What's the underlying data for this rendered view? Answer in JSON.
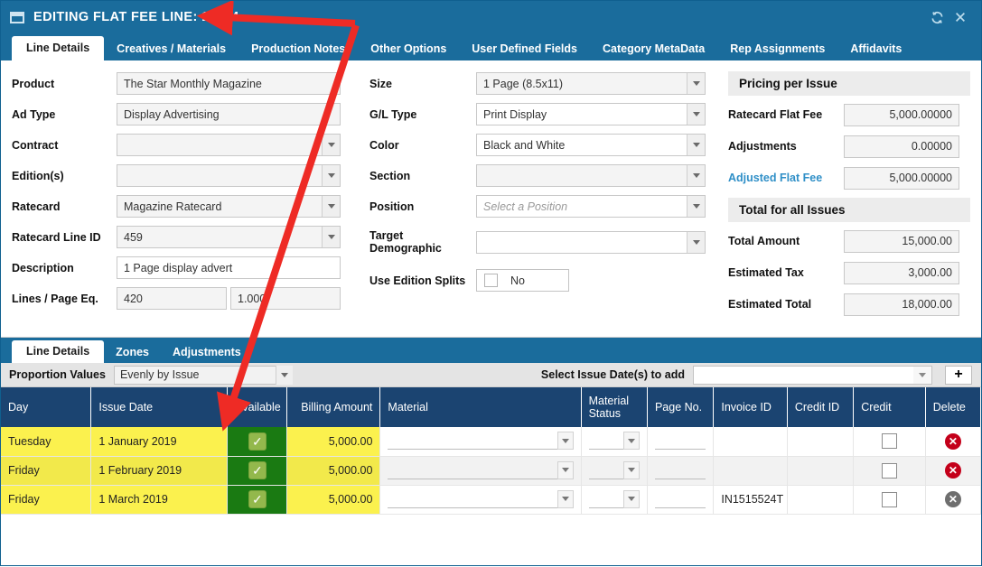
{
  "window": {
    "title": "EDITING FLAT FEE LINE: 11644",
    "icon": "window-icon",
    "refresh_label": "refresh-icon",
    "close_label": "×"
  },
  "top_tabs": [
    {
      "label": "Line Details",
      "active": true
    },
    {
      "label": "Creatives / Materials",
      "active": false
    },
    {
      "label": "Production Notes",
      "active": false
    },
    {
      "label": "Other Options",
      "active": false
    },
    {
      "label": "User Defined Fields",
      "active": false
    },
    {
      "label": "Category MetaData",
      "active": false
    },
    {
      "label": "Rep Assignments",
      "active": false
    },
    {
      "label": "Affidavits",
      "active": false
    }
  ],
  "form_left": {
    "product_label": "Product",
    "product_value": "The Star Monthly Magazine",
    "ad_type_label": "Ad Type",
    "ad_type_value": "Display Advertising",
    "contract_label": "Contract",
    "contract_value": "",
    "editions_label": "Edition(s)",
    "editions_value": "",
    "ratecard_label": "Ratecard",
    "ratecard_value": "Magazine Ratecard",
    "ratecard_line_id_label": "Ratecard Line ID",
    "ratecard_line_id_value": "459",
    "description_label": "Description",
    "description_value": "1 Page display advert",
    "lines_page_label": "Lines / Page Eq.",
    "lines_value": "420",
    "page_eq_value": "1.000"
  },
  "form_mid": {
    "size_label": "Size",
    "size_value": "1 Page (8.5x11)",
    "gl_type_label": "G/L Type",
    "gl_type_value": "Print Display",
    "color_label": "Color",
    "color_value": "Black and White",
    "section_label": "Section",
    "section_value": "",
    "position_label": "Position",
    "position_placeholder": "Select a Position",
    "target_demographic_label": "Target Demographic",
    "target_demographic_value": "",
    "use_edition_splits_label": "Use Edition Splits",
    "use_edition_splits_value": "No",
    "use_edition_splits_checked": false
  },
  "pricing": {
    "per_issue_heading": "Pricing per Issue",
    "rows": [
      {
        "label": "Ratecard Flat Fee",
        "value": "5,000.00000",
        "accent": false
      },
      {
        "label": "Adjustments",
        "value": "0.00000",
        "accent": false
      },
      {
        "label": "Adjusted Flat Fee",
        "value": "5,000.00000",
        "accent": true
      }
    ],
    "total_heading": "Total for all Issues",
    "totals": [
      {
        "label": "Total Amount",
        "value": "15,000.00"
      },
      {
        "label": "Estimated Tax",
        "value": "3,000.00"
      },
      {
        "label": "Estimated Total",
        "value": "18,000.00"
      }
    ],
    "accent_color": "#2f8fc7"
  },
  "bottom_tabs": [
    {
      "label": "Line Details",
      "active": true
    },
    {
      "label": "Zones",
      "active": false
    },
    {
      "label": "Adjustments",
      "active": false
    }
  ],
  "sub_toolbar": {
    "proportion_label": "Proportion Values",
    "proportion_value": "Evenly by Issue",
    "select_issue_label": "Select Issue Date(s) to add",
    "select_issue_value": "",
    "add_button_label": "+"
  },
  "grid": {
    "columns": [
      "Day",
      "Issue Date",
      "Available",
      "Billing Amount",
      "Material",
      "Material Status",
      "Page No.",
      "Invoice ID",
      "Credit ID",
      "Credit",
      "Delete"
    ],
    "rows": [
      {
        "day": "Tuesday",
        "issue_date": "1 January 2019",
        "available": true,
        "billing_amount": "5,000.00",
        "material": "",
        "material_status": "",
        "page_no": "",
        "invoice_id": "",
        "credit_id": "",
        "credit": false,
        "delete_enabled": true
      },
      {
        "day": "Friday",
        "issue_date": "1 February 2019",
        "available": true,
        "billing_amount": "5,000.00",
        "material": "",
        "material_status": "",
        "page_no": "",
        "invoice_id": "",
        "credit_id": "",
        "credit": false,
        "delete_enabled": true
      },
      {
        "day": "Friday",
        "issue_date": "1 March 2019",
        "available": true,
        "billing_amount": "5,000.00",
        "material": "",
        "material_status": "",
        "page_no": "",
        "invoice_id": "IN1515524T",
        "credit_id": "",
        "credit": false,
        "delete_enabled": false
      }
    ],
    "header_color": "#1b4471",
    "highlight_color": "#fbf14e",
    "available_color": "#1a7a12"
  },
  "annotation": {
    "color": "#ee2b25",
    "arrow_count": 2
  }
}
